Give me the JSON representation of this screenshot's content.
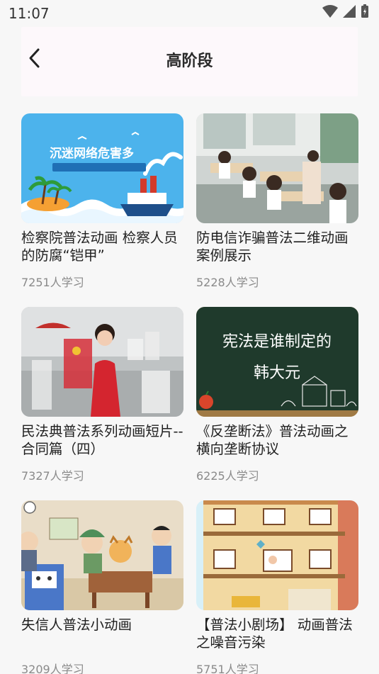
{
  "status": {
    "time": "11:07"
  },
  "header": {
    "title": "高阶段"
  },
  "courses": [
    {
      "title": "检察院普法动画 检察人员的防腐“铠甲”",
      "count": "7251人学习",
      "thumb_text": "沉迷网络危害多"
    },
    {
      "title": "防电信诈骗普法二维动画案例展示",
      "count": "5228人学习"
    },
    {
      "title": "民法典普法系列动画短片--合同篇（四）",
      "count": "7327人学习"
    },
    {
      "title": "《反垄断法》普法动画之横向垄断协议",
      "count": "6225人学习",
      "thumb_line1": "宪法是谁制定的",
      "thumb_line2": "韩大元"
    },
    {
      "title": "失信人普法小动画",
      "count": "3209人学习"
    },
    {
      "title": "【普法小剧场】 动画普法之噪音污染",
      "count": "5751人学习"
    }
  ]
}
